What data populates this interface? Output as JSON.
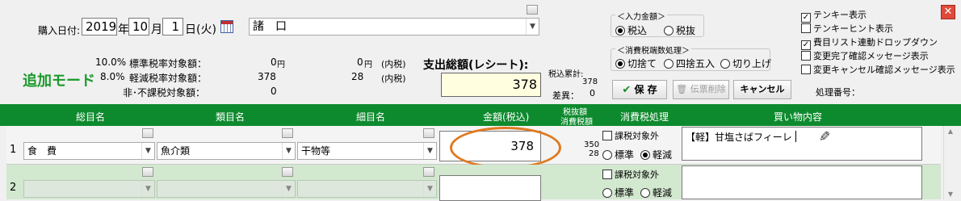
{
  "header": {
    "date_label": "購入日付:",
    "year": "2019",
    "year_unit": "年",
    "month": "10",
    "month_unit": "月",
    "day": "1",
    "day_unit": "日",
    "weekday": "(火)",
    "store": "諸　口",
    "mode": "追加モード"
  },
  "tax_summary": {
    "rows": [
      {
        "rate": "10.0%",
        "label": "標準税率対象額：",
        "amount": "0",
        "unit": "円",
        "incl": "0",
        "incl_unit": "円",
        "note": "(内税)"
      },
      {
        "rate": "8.0%",
        "label": "軽減税率対象額：",
        "amount": "378",
        "incl": "28",
        "note": "(内税)"
      },
      {
        "rate": "",
        "label": "非･不課税対象額：",
        "amount": "0"
      }
    ]
  },
  "total": {
    "label": "支出総額(レシート):",
    "value": "378",
    "sum_label": "税込累計:",
    "sum_value": "378",
    "diff_label": "差異：",
    "diff_value": "0"
  },
  "input_amount": {
    "title": "＜入力金額＞",
    "options": [
      "税込",
      "税抜"
    ],
    "selected": "税込"
  },
  "rounding": {
    "title": "＜消費税端数処理＞",
    "options": [
      "切捨て",
      "四捨五入",
      "切り上げ"
    ],
    "selected": "切捨て"
  },
  "buttons": {
    "save": "保 存",
    "delete": "伝票削除",
    "cancel": "キャンセル"
  },
  "options": [
    {
      "label": "テンキー表示",
      "checked": true
    },
    {
      "label": "テンキーヒント表示",
      "checked": false
    },
    {
      "label": "費目リスト連動ドロップダウン",
      "checked": true
    },
    {
      "label": "変更完了確認メッセージ表示",
      "checked": false
    },
    {
      "label": "変更キャンセル確認メッセージ表示",
      "checked": false
    }
  ],
  "process_no_label": "処理番号：",
  "columns": {
    "category": "総目名",
    "type": "類目名",
    "item": "細目名",
    "amount": "金額(税込)",
    "tax_a": "税抜額",
    "tax_b": "消費税額",
    "tax_proc": "消費税処理",
    "content": "買い物内容"
  },
  "rows": [
    {
      "no": "1",
      "category": "食　費",
      "type": "魚介類",
      "item": "干物等",
      "amount": "378",
      "net": "350",
      "tax": "28",
      "exempt_label": "課税対象外",
      "std_label": "標準",
      "reduced_label": "軽減",
      "selected": "軽減",
      "content": "【軽】甘塩さばフィーレ"
    },
    {
      "no": "2",
      "category": "",
      "type": "",
      "item": "",
      "amount": "",
      "exempt_label": "課税対象外",
      "std_label": "標準",
      "reduced_label": "軽減",
      "content": ""
    }
  ],
  "colors": {
    "header_green": "#0e8a2e",
    "mode_green": "#1a9a2a",
    "highlight_orange": "#e07a20",
    "total_bg": "#ffffe0",
    "row2_bg": "#d2e8cf"
  }
}
